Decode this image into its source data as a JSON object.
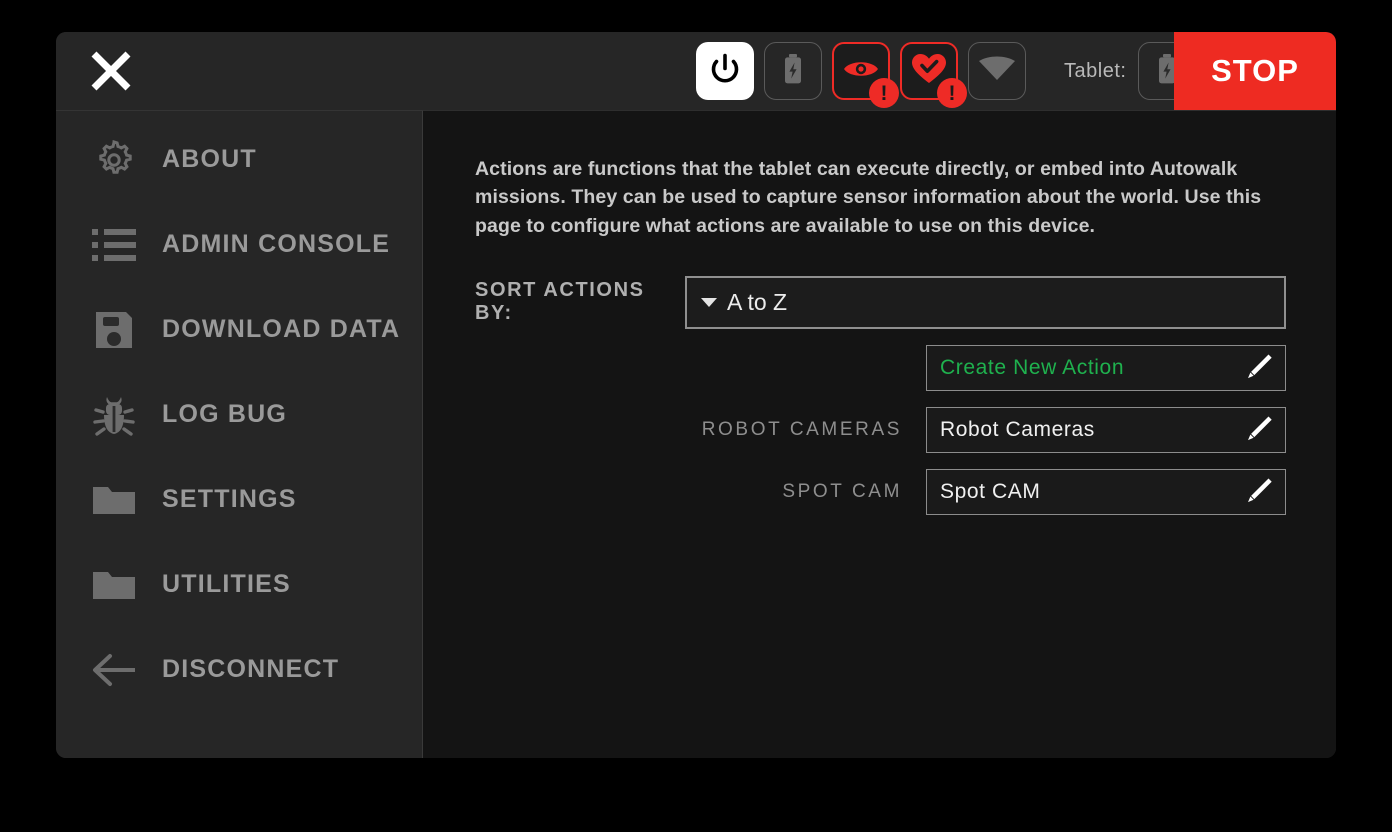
{
  "window": {
    "close_icon": "close-icon"
  },
  "topbar": {
    "power_icon": "power-icon",
    "battery_icon": "battery-charging-icon",
    "vision_icon": "eye-icon",
    "vision_alert": "!",
    "health_icon": "heart-check-icon",
    "health_alert": "!",
    "wifi_icon": "wifi-icon",
    "tablet_label": "Tablet:",
    "tablet_battery_icon": "battery-charging-icon",
    "stop_label": "STOP",
    "stop_color": "#ee2b22",
    "alert_color": "#ee2b26"
  },
  "sidebar": {
    "items": [
      {
        "label": "ABOUT",
        "icon": "gear-icon"
      },
      {
        "label": "ADMIN CONSOLE",
        "icon": "list-icon"
      },
      {
        "label": "DOWNLOAD DATA",
        "icon": "save-disk-icon"
      },
      {
        "label": "LOG BUG",
        "icon": "bug-icon"
      },
      {
        "label": "SETTINGS",
        "icon": "folder-icon"
      },
      {
        "label": "UTILITIES",
        "icon": "folder-icon"
      },
      {
        "label": "DISCONNECT",
        "icon": "arrow-left-icon"
      }
    ]
  },
  "main": {
    "description": "Actions are functions that the tablet can execute directly, or embed into Autowalk missions. They can be used to capture sensor information about the world. Use this page to configure what actions are available to use on this device.",
    "sort": {
      "label": "SORT ACTIONS BY:",
      "value": "A to Z",
      "caret_icon": "chevron-down-icon"
    },
    "actions": [
      {
        "row_label": "",
        "button_label": "Create New Action",
        "accent": true,
        "edit_icon": "pencil-icon"
      },
      {
        "row_label": "ROBOT CAMERAS",
        "button_label": "Robot Cameras",
        "accent": false,
        "edit_icon": "pencil-icon"
      },
      {
        "row_label": "SPOT CAM",
        "button_label": "Spot CAM",
        "accent": false,
        "edit_icon": "pencil-icon"
      }
    ],
    "accent_color": "#1fb14e"
  }
}
